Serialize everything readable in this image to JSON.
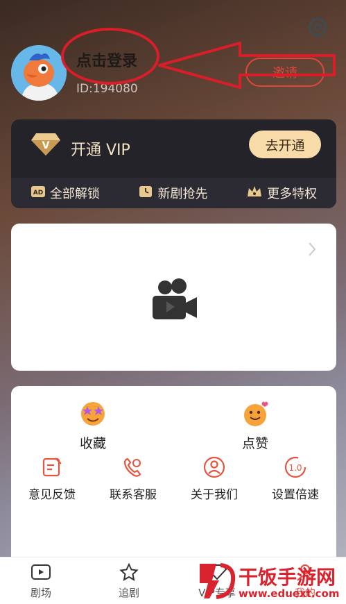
{
  "header": {
    "login_text": "点击登录",
    "user_id": "ID:194080",
    "invite_label": "邀请"
  },
  "vip": {
    "title": "开通 VIP",
    "button": "去开通",
    "perks": [
      {
        "icon": "ad-icon",
        "label": "全部解锁"
      },
      {
        "icon": "clock-icon",
        "label": "新剧抢先"
      },
      {
        "icon": "crown-icon",
        "label": "更多特权"
      }
    ]
  },
  "features": {
    "big": [
      {
        "label": "收藏",
        "icon": "favorite-emoji-icon"
      },
      {
        "label": "点赞",
        "icon": "like-emoji-icon"
      }
    ],
    "small": [
      {
        "label": "意见反馈",
        "icon": "feedback-icon"
      },
      {
        "label": "联系客服",
        "icon": "phone-icon"
      },
      {
        "label": "关于我们",
        "icon": "user-icon"
      },
      {
        "label": "设置倍速",
        "icon": "speed-icon",
        "badge": "1.0"
      }
    ]
  },
  "tabbar": {
    "items": [
      {
        "label": "剧场",
        "icon": "video-icon",
        "active": false
      },
      {
        "label": "追剧",
        "icon": "star-icon",
        "active": false
      },
      {
        "label": "VIP专享",
        "icon": "vip-icon",
        "active": false
      },
      {
        "label": "我的",
        "icon": "profile-icon",
        "active": true
      }
    ]
  },
  "watermark": {
    "name": "干饭手游网",
    "url": "www.eduext.com"
  },
  "colors": {
    "accent": "#e84b3a",
    "vip_gold": "#f7dca9",
    "annotation_red": "#d91e2a"
  }
}
